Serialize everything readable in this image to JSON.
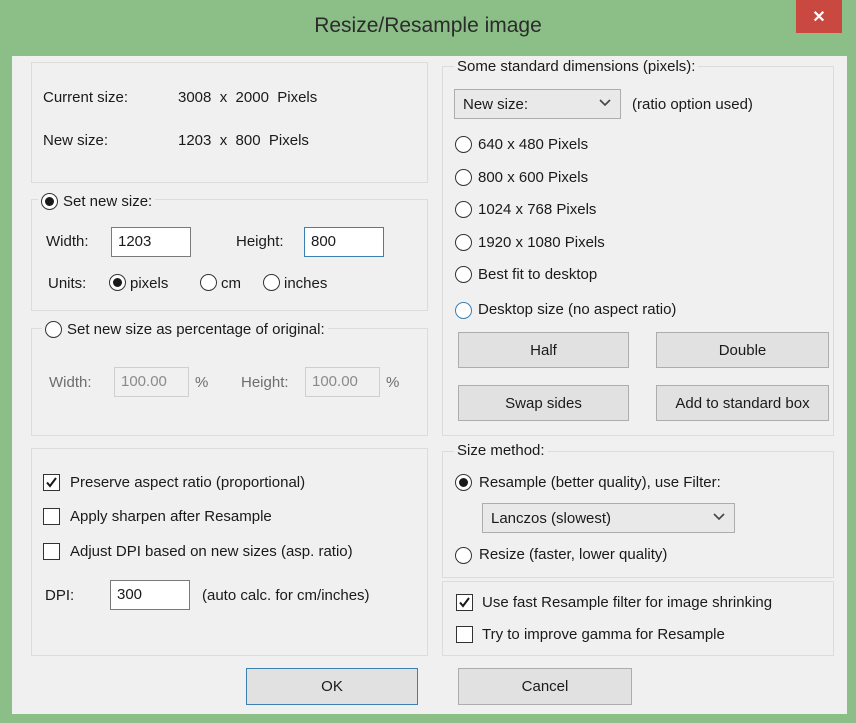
{
  "window": {
    "title": "Resize/Resample image",
    "close_glyph": "✕"
  },
  "info": {
    "current_label": "Current size:",
    "current_value": "3008  x  2000  Pixels",
    "new_label": "New size:",
    "new_value": "1203  x  800  Pixels"
  },
  "set_size": {
    "legend": "Set new size:",
    "width_label": "Width:",
    "width_value": "1203",
    "height_label": "Height:",
    "height_value": "800",
    "units_label": "Units:",
    "unit_pixels": "pixels",
    "unit_cm": "cm",
    "unit_inches": "inches",
    "selected_unit": "pixels"
  },
  "percent": {
    "legend": "Set new size as percentage of original:",
    "width_label": "Width:",
    "width_value": "100.00",
    "width_unit": "%",
    "height_label": "Height:",
    "height_value": "100.00",
    "height_unit": "%"
  },
  "options": {
    "preserve": "Preserve aspect ratio (proportional)",
    "preserve_checked": true,
    "sharpen": "Apply sharpen after Resample",
    "sharpen_checked": false,
    "adjust_dpi": "Adjust DPI based on new sizes (asp. ratio)",
    "adjust_dpi_checked": false,
    "dpi_label": "DPI:",
    "dpi_value": "300",
    "dpi_note": "(auto calc. for cm/inches)"
  },
  "standard": {
    "legend": "Some standard dimensions (pixels):",
    "combo_value": "New size:",
    "ratio_note": "(ratio option used)",
    "opt1": "640 x 480 Pixels",
    "opt2": "800 x 600 Pixels",
    "opt3": "1024 x 768 Pixels",
    "opt4": "1920 x 1080 Pixels",
    "opt5": "Best fit to desktop",
    "opt6": "Desktop size (no aspect ratio)",
    "half": "Half",
    "double": "Double",
    "swap": "Swap sides",
    "add_box": "Add to standard box"
  },
  "method": {
    "legend": "Size method:",
    "resample": "Resample (better quality), use Filter:",
    "filter_value": "Lanczos (slowest)",
    "resize": "Resize (faster, lower quality)",
    "selected": "resample"
  },
  "fast": {
    "fast_filter": "Use fast Resample filter for image shrinking",
    "fast_checked": true,
    "gamma": "Try to improve gamma for Resample",
    "gamma_checked": false
  },
  "footer": {
    "ok": "OK",
    "cancel": "Cancel"
  }
}
